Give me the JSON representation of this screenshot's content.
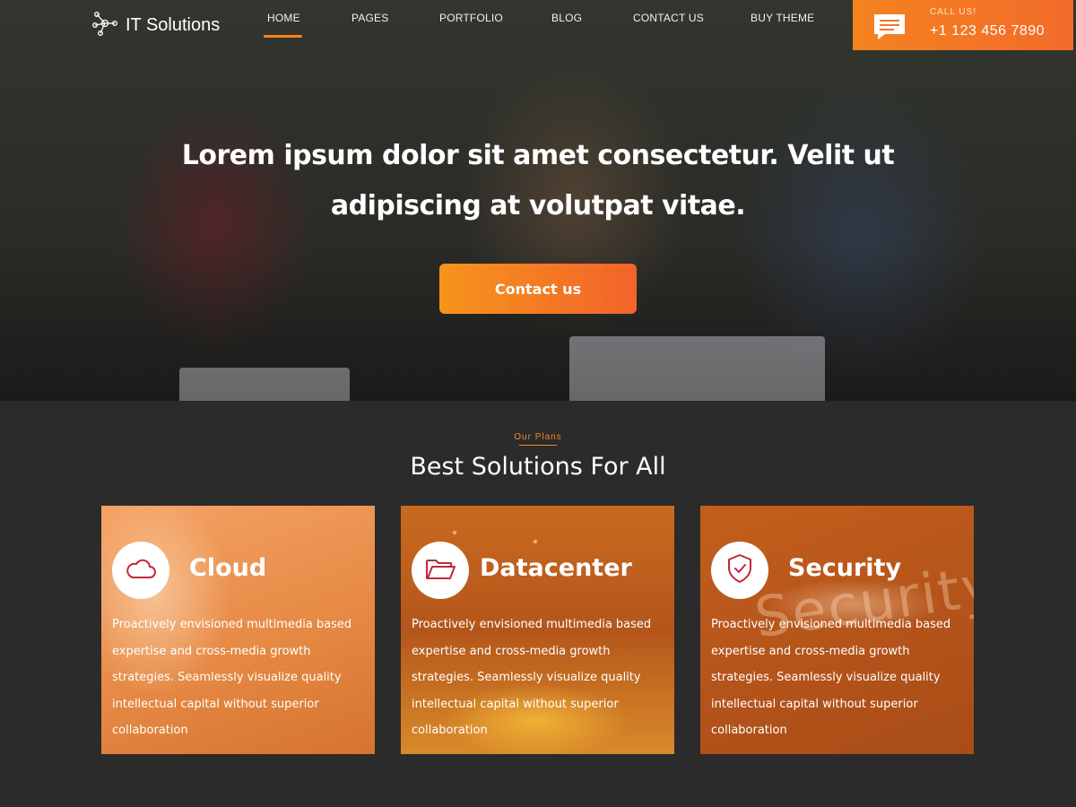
{
  "brand": {
    "name": "IT Solutions",
    "logo_icon": "network-nodes-icon"
  },
  "nav": {
    "items": [
      {
        "label": "HOME",
        "active": true
      },
      {
        "label": "PAGES"
      },
      {
        "label": "PORTFOLIO"
      },
      {
        "label": "BLOG"
      },
      {
        "label": "CONTACT US"
      },
      {
        "label": "BUY THEME"
      }
    ]
  },
  "call": {
    "label": "CALL US!",
    "number": "+1 123 456 7890",
    "icon": "chat-icon"
  },
  "hero": {
    "headline": "Lorem ipsum dolor sit amet consectetur. Velit ut adipiscing at volutpat vitae.",
    "cta_label": "Contact us"
  },
  "plans": {
    "kicker": "Our Plans",
    "title": "Best Solutions For All",
    "cards": [
      {
        "title": "Cloud",
        "icon": "cloud-icon",
        "text": "Proactively envisioned multimedia based expertise and cross-media growth strategies. Seamlessly visualize quality intellectual capital without superior collaboration"
      },
      {
        "title": "Datacenter",
        "icon": "folder-icon",
        "text": "Proactively envisioned multimedia based expertise and cross-media growth strategies. Seamlessly visualize quality intellectual capital without superior collaboration"
      },
      {
        "title": "Security",
        "icon": "shield-check-icon",
        "watermark": "Security",
        "text": "Proactively envisioned multimedia based expertise and cross-media growth strategies. Seamlessly visualize quality intellectual capital without superior collaboration"
      }
    ]
  },
  "colors": {
    "accent": "#f58220",
    "icon_red": "#c0283a",
    "background": "#2b2b2b"
  }
}
